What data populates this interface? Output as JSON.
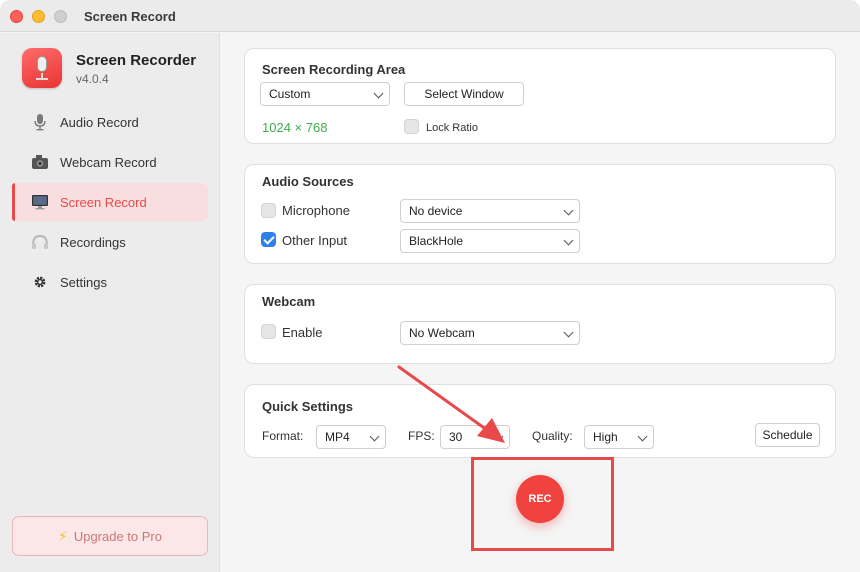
{
  "window": {
    "title": "Screen Record"
  },
  "app": {
    "name": "Screen Recorder",
    "version": "v4.0.4"
  },
  "sidebar": {
    "items": [
      {
        "label": "Audio Record",
        "icon": "microphone-icon",
        "active": false
      },
      {
        "label": "Webcam Record",
        "icon": "webcam-icon",
        "active": false
      },
      {
        "label": "Screen Record",
        "icon": "monitor-icon",
        "active": true
      },
      {
        "label": "Recordings",
        "icon": "headphones-icon",
        "active": false
      },
      {
        "label": "Settings",
        "icon": "gear-icon",
        "active": false
      }
    ],
    "upgrade_icon": "⚡",
    "upgrade_label": "Upgrade to Pro"
  },
  "recording_area": {
    "title": "Screen Recording Area",
    "area_select": "Custom",
    "select_window_label": "Select Window",
    "resolution": "1024 × 768",
    "lock_ratio_label": "Lock Ratio",
    "lock_ratio_checked": false
  },
  "audio_sources": {
    "title": "Audio Sources",
    "microphone": {
      "label": "Microphone",
      "checked": false,
      "device": "No device"
    },
    "other_input": {
      "label": "Other Input",
      "checked": true,
      "device": "BlackHole"
    }
  },
  "webcam": {
    "title": "Webcam",
    "enable_label": "Enable",
    "enable_checked": false,
    "device": "No Webcam"
  },
  "quick_settings": {
    "title": "Quick Settings",
    "format_label": "Format:",
    "format_value": "MP4",
    "fps_label": "FPS:",
    "fps_value": "30",
    "quality_label": "Quality:",
    "quality_value": "High",
    "schedule_label": "Schedule"
  },
  "rec_button_label": "REC",
  "colors": {
    "accent": "#e84a4a",
    "rec": "#f0423f",
    "resolution_text": "#3fae4c",
    "checkbox_checked": "#2f80ed"
  }
}
